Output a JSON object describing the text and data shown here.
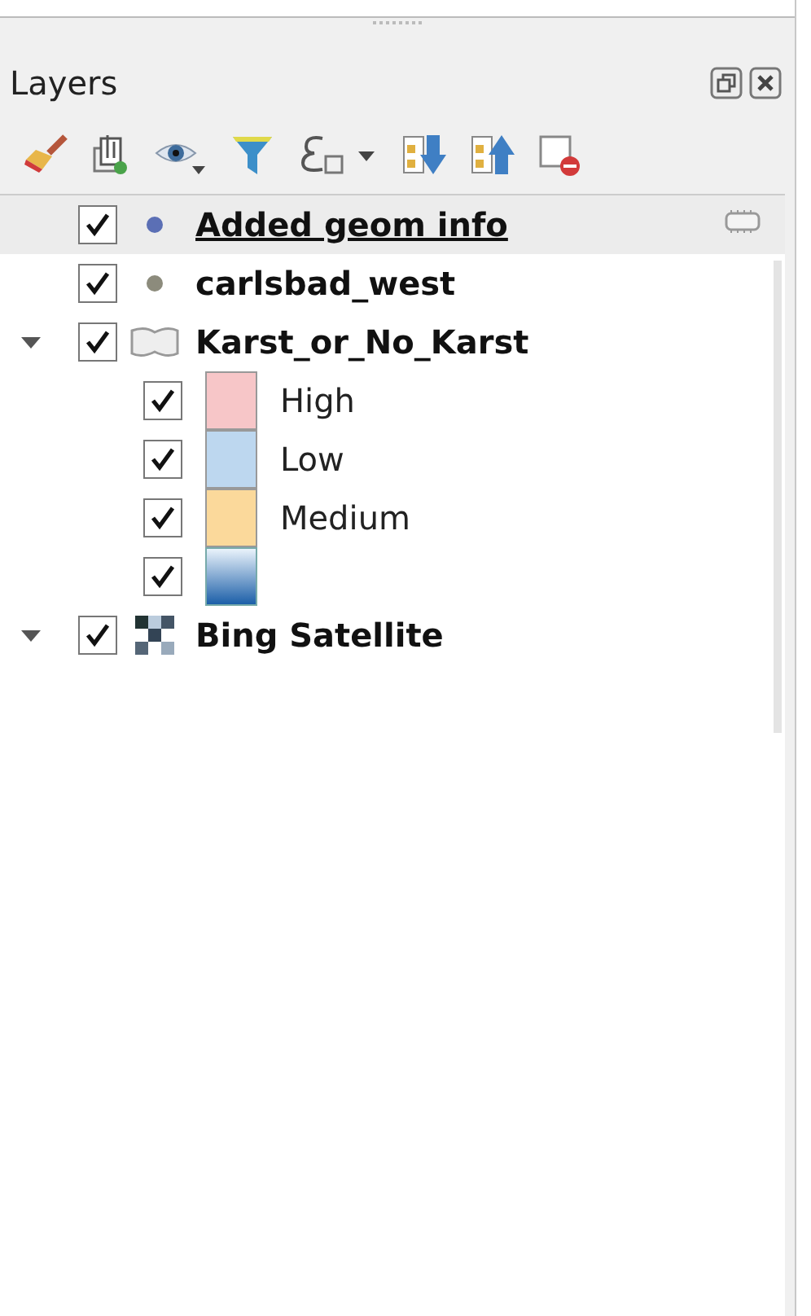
{
  "panel": {
    "title": "Layers"
  },
  "layers": [
    {
      "name": "Added geom info",
      "kind": "point",
      "color": "#5b6fb5",
      "checked": true,
      "selected": true,
      "indicator": true
    },
    {
      "name": "carlsbad_west",
      "kind": "point",
      "color": "#8c8b7c",
      "checked": true,
      "selected": false
    },
    {
      "name": "Karst_or_No_Karst",
      "kind": "polygon",
      "checked": true,
      "selected": false,
      "expanded": true,
      "children": [
        {
          "label": "High",
          "kind": "swatch",
          "color": "#f7c6c8",
          "checked": true
        },
        {
          "label": "Low",
          "kind": "swatch",
          "color": "#bdd7ef",
          "checked": true
        },
        {
          "label": "Medium",
          "kind": "swatch",
          "color": "#fbd99b",
          "checked": true
        },
        {
          "kind": "gradient",
          "checked": true
        }
      ]
    },
    {
      "name": "Bing Satellite",
      "kind": "raster",
      "checked": true,
      "selected": false,
      "expanded": true
    }
  ]
}
